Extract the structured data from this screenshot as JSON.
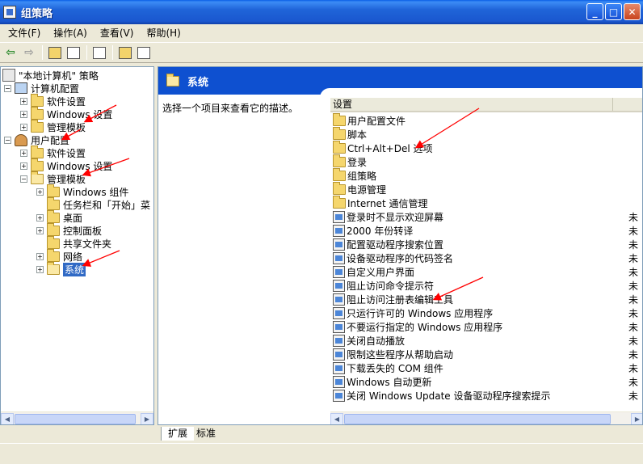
{
  "window": {
    "title": "组策略",
    "controls": [
      "_",
      "□",
      "✕"
    ]
  },
  "menu": [
    "文件(F)",
    "操作(A)",
    "查看(V)",
    "帮助(H)"
  ],
  "tree": {
    "root": "\"本地计算机\" 策略",
    "computer_config": "计算机配置",
    "cc_software": "软件设置",
    "cc_windows": "Windows 设置",
    "cc_admin": "管理模板",
    "user_config": "用户配置",
    "uc_software": "软件设置",
    "uc_windows": "Windows 设置",
    "uc_admin": "管理模板",
    "at_windows_components": "Windows 组件",
    "at_taskbar": "任务栏和「开始」菜",
    "at_desktop": "桌面",
    "at_control_panel": "控制面板",
    "at_shared_folders": "共享文件夹",
    "at_network": "网络",
    "at_system": "系统"
  },
  "right": {
    "header_title": "系统",
    "description": "选择一个项目来查看它的描述。",
    "column_setting": "设置",
    "items": [
      {
        "type": "folder",
        "label": "用户配置文件"
      },
      {
        "type": "folder",
        "label": "脚本"
      },
      {
        "type": "folder",
        "label": "Ctrl+Alt+Del 选项"
      },
      {
        "type": "folder",
        "label": "登录"
      },
      {
        "type": "folder",
        "label": "组策略"
      },
      {
        "type": "folder",
        "label": "电源管理"
      },
      {
        "type": "folder",
        "label": "Internet 通信管理"
      },
      {
        "type": "setting",
        "label": "登录时不显示欢迎屏幕"
      },
      {
        "type": "setting",
        "label": "2000 年份转译"
      },
      {
        "type": "setting",
        "label": "配置驱动程序搜索位置"
      },
      {
        "type": "setting",
        "label": "设备驱动程序的代码签名"
      },
      {
        "type": "setting",
        "label": "自定义用户界面"
      },
      {
        "type": "setting",
        "label": "阻止访问命令提示符"
      },
      {
        "type": "setting",
        "label": "阻止访问注册表编辑工具"
      },
      {
        "type": "setting",
        "label": "只运行许可的 Windows 应用程序"
      },
      {
        "type": "setting",
        "label": "不要运行指定的 Windows 应用程序"
      },
      {
        "type": "setting",
        "label": "关闭自动播放"
      },
      {
        "type": "setting",
        "label": "限制这些程序从帮助启动"
      },
      {
        "type": "setting",
        "label": "下载丢失的 COM 组件"
      },
      {
        "type": "setting",
        "label": "Windows 自动更新"
      },
      {
        "type": "setting",
        "label": "关闭 Windows Update 设备驱动程序搜索提示"
      }
    ],
    "trail_char": "未"
  },
  "tabs": {
    "extended": "扩展",
    "standard": "标准"
  },
  "colors": {
    "accent": "#0E50D0",
    "selection": "#316AC5",
    "annotation": "#FF0000"
  }
}
